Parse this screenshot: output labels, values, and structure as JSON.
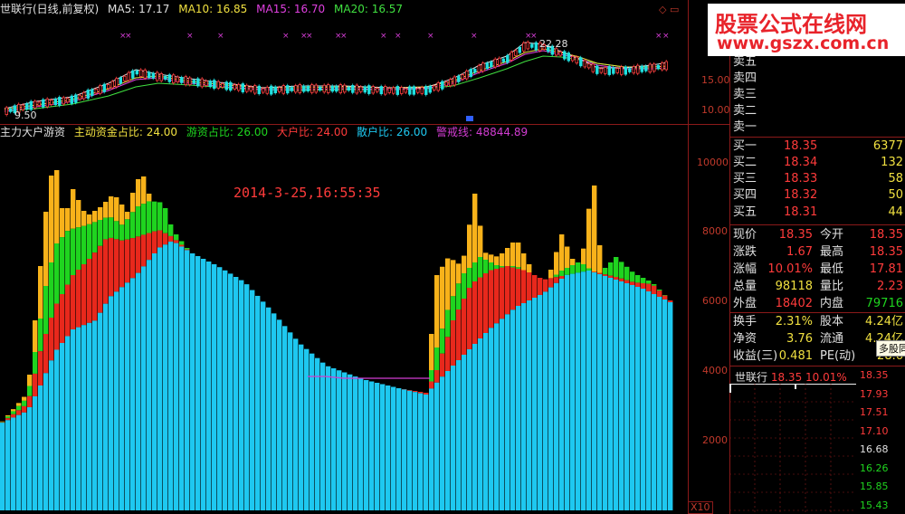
{
  "header": {
    "stock_title": "世联行(日线,前复权)",
    "ma5": "MA5: 17.17",
    "ma10": "MA10: 16.85",
    "ma15": "MA15: 16.70",
    "ma20": "MA20: 16.57"
  },
  "main_chart": {
    "high_label": "22.28",
    "low_label": "9.50",
    "axis": [
      "15.00",
      "10.00"
    ]
  },
  "indicator": {
    "name": "主力大户游资",
    "main_ratio": "主动资金占比: 24.00",
    "hot_ratio": "游资占比: 26.00",
    "big_ratio": "大户比: 24.00",
    "retail_ratio": "散户比: 26.00",
    "alert_line": "警戒线: 48844.89",
    "axis": [
      "10000",
      "8000",
      "6000",
      "4000",
      "2000"
    ],
    "timestamp": "2014-3-25,16:55:35",
    "scale_label": "X10",
    "colors": {
      "blue": "#1ec8f0",
      "red": "#e8281c",
      "green": "#1fd41f",
      "orange": "#f8b21a",
      "magenta": "#d23cd2"
    }
  },
  "watermark": {
    "line1": "股票公式在线网",
    "line2": "www.gszx.com.cn"
  },
  "order_book": {
    "sells": [
      {
        "label": "卖五"
      },
      {
        "label": "卖四"
      },
      {
        "label": "卖三"
      },
      {
        "label": "卖二"
      },
      {
        "label": "卖一"
      }
    ],
    "buys": [
      {
        "label": "买一",
        "price": "18.35",
        "vol": "6377"
      },
      {
        "label": "买二",
        "price": "18.34",
        "vol": "132"
      },
      {
        "label": "买三",
        "price": "18.33",
        "vol": "58"
      },
      {
        "label": "买四",
        "price": "18.32",
        "vol": "50"
      },
      {
        "label": "买五",
        "price": "18.31",
        "vol": "44"
      }
    ]
  },
  "quote": {
    "rows": [
      {
        "l1": "现价",
        "v1": "18.35",
        "l2": "今开",
        "v2": "18.35",
        "c1": "#ff3b3b",
        "c2": "#ff3b3b"
      },
      {
        "l1": "涨跌",
        "v1": "1.67",
        "l2": "最高",
        "v2": "18.35",
        "c1": "#ff3b3b",
        "c2": "#ff3b3b"
      },
      {
        "l1": "涨幅",
        "v1": "10.01%",
        "l2": "最低",
        "v2": "17.81",
        "c1": "#ff3b3b",
        "c2": "#ff3b3b"
      },
      {
        "l1": "总量",
        "v1": "98118",
        "l2": "量比",
        "v2": "2.23",
        "c1": "#f0e040",
        "c2": "#ff3b3b"
      },
      {
        "l1": "外盘",
        "v1": "18402",
        "l2": "内盘",
        "v2": "79716",
        "c1": "#ff3b3b",
        "c2": "#1fd41f"
      },
      {
        "l1": "换手",
        "v1": "2.31%",
        "l2": "股本",
        "v2": "4.24亿",
        "c1": "#f0e040",
        "c2": "#f0e040"
      },
      {
        "l1": "净资",
        "v1": "3.76",
        "l2": "流通",
        "v2": "4.24亿",
        "c1": "#f0e040",
        "c2": "#f0e040"
      },
      {
        "l1": "收益(三)",
        "v1": "0.481",
        "l2": "PE(动)",
        "v2": "28.6",
        "c1": "#f0e040",
        "c2": "#f0e040"
      }
    ],
    "tooltip": "多股同列"
  },
  "mini_chart": {
    "title": "世联行",
    "price": "18.35",
    "pct": "10.01%",
    "axis": [
      "18.35",
      "17.93",
      "17.51",
      "17.10",
      "16.68",
      "16.26",
      "15.85",
      "15.43"
    ]
  }
}
